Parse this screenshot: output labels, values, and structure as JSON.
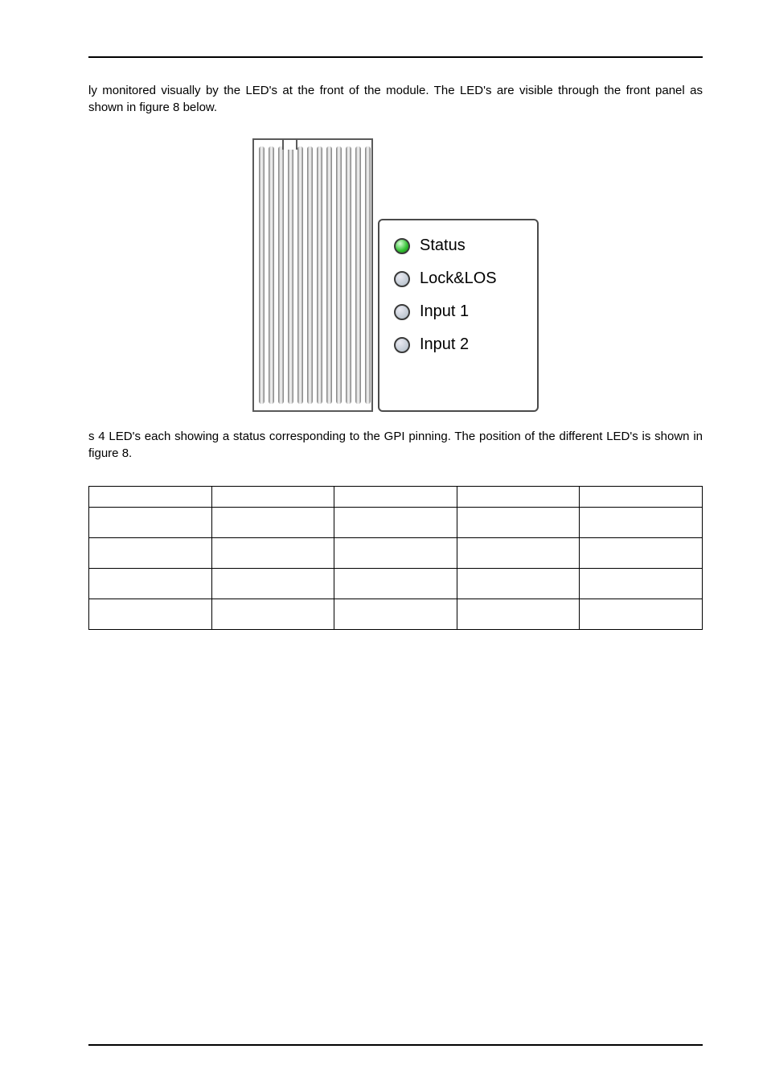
{
  "para1": "ly monitored visually by the LED's at the front of the module. The LED's are visible through the front panel as shown in figure 8 below.",
  "leds": {
    "row0": "Status",
    "row1": "Lock&LOS",
    "row2": "Input 1",
    "row3": "Input 2"
  },
  "para2": "s 4 LED's each showing a status corresponding to the GPI pinning. The position of the different LED's is shown in figure 8.",
  "table": {
    "headers": [
      "",
      "",
      "",
      "",
      ""
    ],
    "rows": [
      [
        "",
        "",
        "",
        "",
        ""
      ],
      [
        "",
        "",
        "",
        "",
        ""
      ],
      [
        "",
        "",
        "",
        "",
        ""
      ],
      [
        "",
        "",
        "",
        "",
        ""
      ]
    ]
  }
}
